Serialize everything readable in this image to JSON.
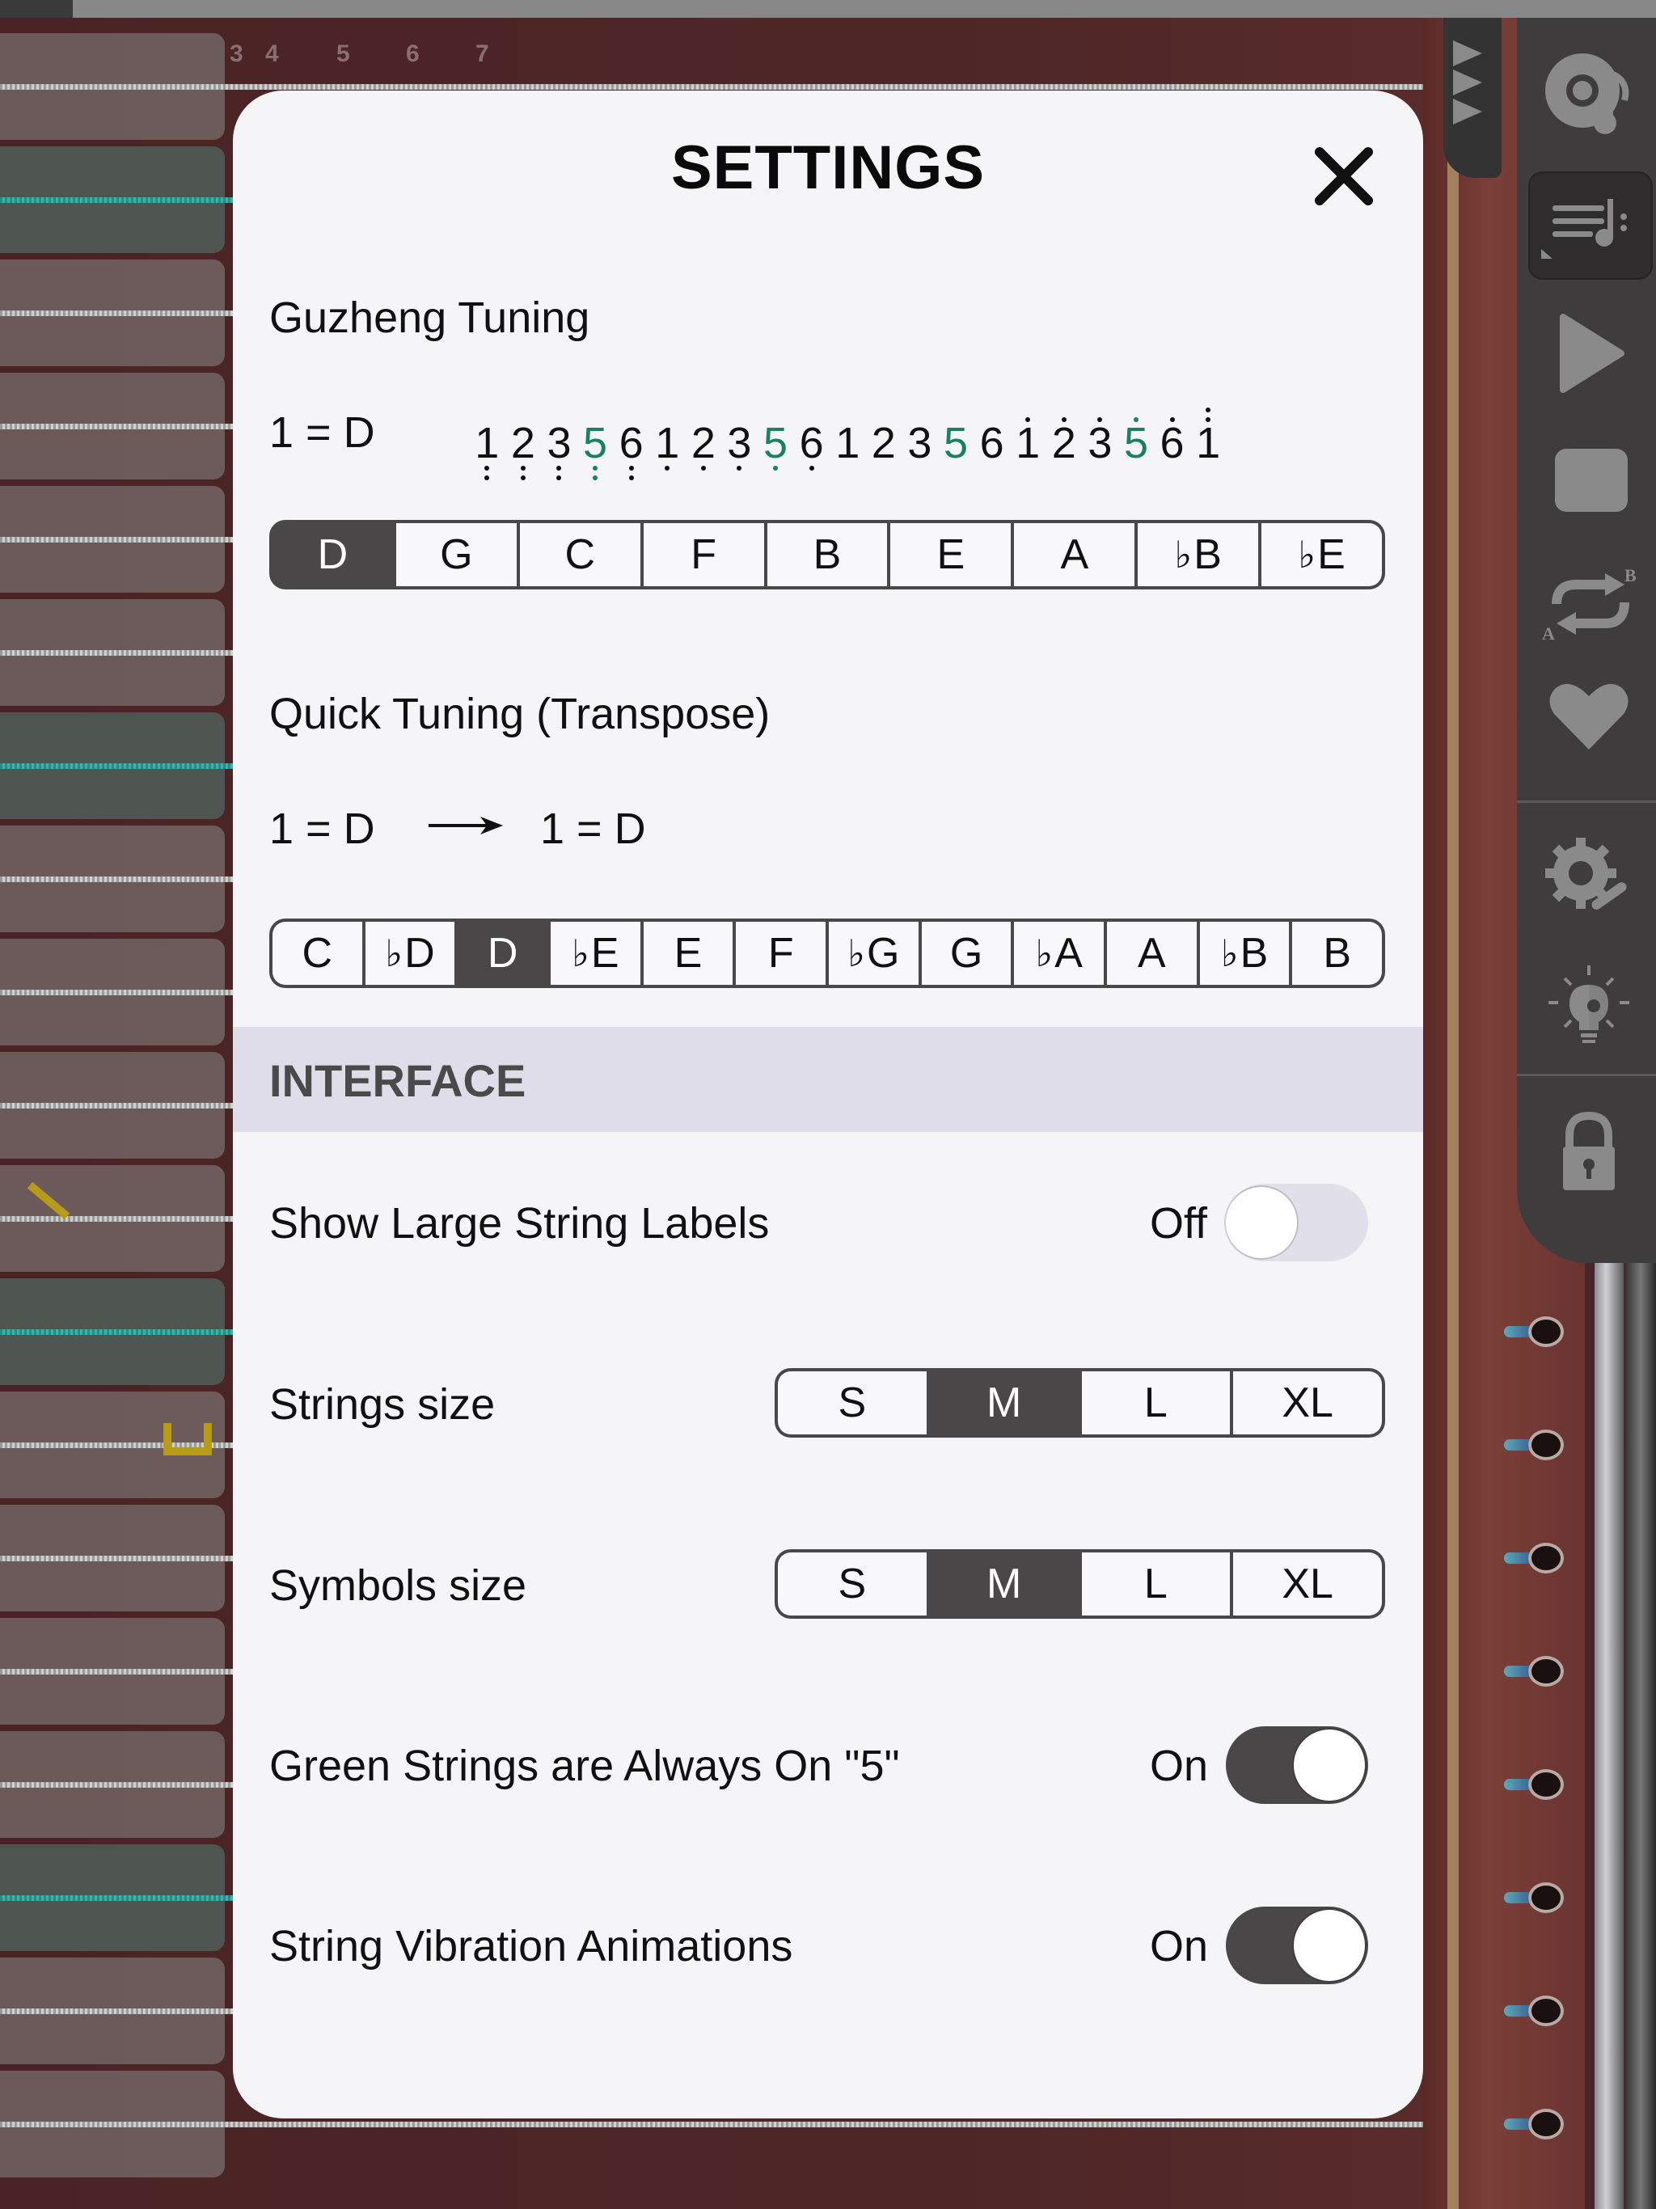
{
  "background": {
    "ruler_numbers": [
      "3",
      "4",
      "5",
      "6",
      "7"
    ]
  },
  "toolbar": {
    "items": [
      {
        "icon": "disc-music-icon",
        "label": "Music library"
      },
      {
        "icon": "score-menu-icon",
        "label": "Song sheet",
        "active": true
      },
      {
        "icon": "play-icon",
        "label": "Play"
      },
      {
        "icon": "stop-icon",
        "label": "Stop"
      },
      {
        "icon": "ab-repeat-icon",
        "label": "A-B repeat"
      },
      {
        "icon": "heart-icon",
        "label": "Favorites"
      },
      {
        "icon": "settings-wrench-icon",
        "label": "Settings"
      },
      {
        "icon": "lightbulb-gear-icon",
        "label": "Tips"
      },
      {
        "icon": "lock-icon",
        "label": "Lock"
      }
    ],
    "collapse_icon": "triple-arrow-icon"
  },
  "settings": {
    "title": "SETTINGS",
    "close_icon": "close-icon",
    "guzheng_tuning": {
      "label": "Guzheng Tuning",
      "key_equation": "1 = D",
      "notes": [
        {
          "n": "1",
          "below": 2
        },
        {
          "n": "2",
          "below": 2
        },
        {
          "n": "3",
          "below": 2
        },
        {
          "n": "5",
          "below": 2,
          "green": true
        },
        {
          "n": "6",
          "below": 2
        },
        {
          "n": "1",
          "below": 1
        },
        {
          "n": "2",
          "below": 1
        },
        {
          "n": "3",
          "below": 1
        },
        {
          "n": "5",
          "below": 1,
          "green": true
        },
        {
          "n": "6",
          "below": 1
        },
        {
          "n": "1"
        },
        {
          "n": "2"
        },
        {
          "n": "3"
        },
        {
          "n": "5",
          "green": true
        },
        {
          "n": "6"
        },
        {
          "n": "1",
          "above": 1
        },
        {
          "n": "2",
          "above": 1
        },
        {
          "n": "3",
          "above": 1
        },
        {
          "n": "5",
          "above": 1,
          "green": true
        },
        {
          "n": "6",
          "above": 1
        },
        {
          "n": "1",
          "above": 2
        }
      ],
      "keys": [
        "D",
        "G",
        "C",
        "F",
        "B",
        "E",
        "A",
        "♭B",
        "♭E"
      ],
      "selected": "D"
    },
    "quick_tuning": {
      "label": "Quick Tuning (Transpose)",
      "from": "1 = D",
      "to": "1 = D",
      "keys": [
        "C",
        "♭D",
        "D",
        "♭E",
        "E",
        "F",
        "♭G",
        "G",
        "♭A",
        "A",
        "♭B",
        "B"
      ],
      "selected": "D"
    },
    "interface": {
      "header": "INTERFACE",
      "show_large_labels": {
        "label": "Show Large String Labels",
        "state": "Off",
        "on": false
      },
      "strings_size": {
        "label": "Strings size",
        "options": [
          "S",
          "M",
          "L",
          "XL"
        ],
        "selected": "M"
      },
      "symbols_size": {
        "label": "Symbols size",
        "options": [
          "S",
          "M",
          "L",
          "XL"
        ],
        "selected": "M"
      },
      "green_strings": {
        "label": "Green Strings are  Always On \"5\"",
        "state": "On",
        "on": true
      },
      "vibration": {
        "label": "String Vibration Animations",
        "state": "On",
        "on": true
      }
    }
  },
  "colors": {
    "green_note": "#1a8060",
    "selected_segment": "#4a4748",
    "toolbar_bg": "#3e3c3d",
    "interface_band": "#dfdde9"
  }
}
